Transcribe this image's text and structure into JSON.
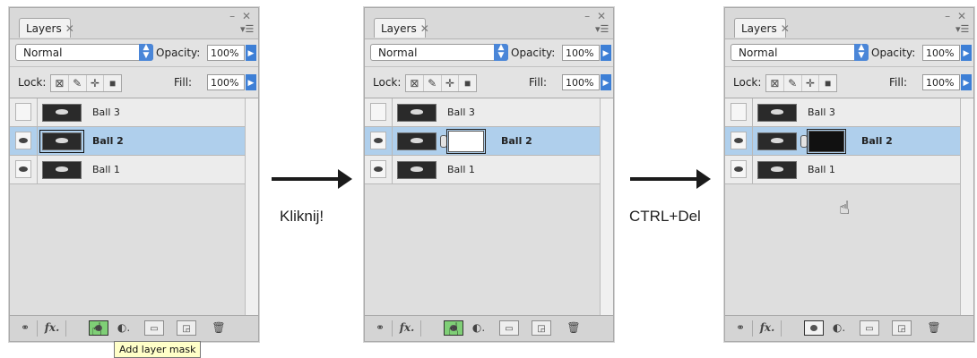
{
  "panels": [
    {
      "tab_label": "Layers",
      "blend_mode": "Normal",
      "opacity_label": "Opacity:",
      "opacity_value": "100%",
      "lock_label": "Lock:",
      "fill_label": "Fill:",
      "fill_value": "100%",
      "layers": [
        {
          "name": "Ball 3",
          "visible": false,
          "selected": false
        },
        {
          "name": "Ball 2",
          "visible": true,
          "selected": true
        },
        {
          "name": "Ball 1",
          "visible": true,
          "selected": false
        }
      ]
    },
    {
      "tab_label": "Layers",
      "blend_mode": "Normal",
      "opacity_label": "Opacity:",
      "opacity_value": "100%",
      "lock_label": "Lock:",
      "fill_label": "Fill:",
      "fill_value": "100%",
      "layers": [
        {
          "name": "Ball 3",
          "visible": false,
          "selected": false
        },
        {
          "name": "Ball 2",
          "visible": true,
          "selected": true,
          "mask": "white"
        },
        {
          "name": "Ball 1",
          "visible": true,
          "selected": false
        }
      ]
    },
    {
      "tab_label": "Layers",
      "blend_mode": "Normal",
      "opacity_label": "Opacity:",
      "opacity_value": "100%",
      "lock_label": "Lock:",
      "fill_label": "Fill:",
      "fill_value": "100%",
      "layers": [
        {
          "name": "Ball 3",
          "visible": false,
          "selected": false
        },
        {
          "name": "Ball 2",
          "visible": true,
          "selected": true,
          "mask": "black"
        },
        {
          "name": "Ball 1",
          "visible": true,
          "selected": false
        }
      ]
    }
  ],
  "tooltip": "Add layer mask",
  "steps": [
    {
      "label": "Kliknij!"
    },
    {
      "label": "CTRL+Del"
    }
  ],
  "bottom_bar_icons": [
    "link-icon",
    "fx-icon",
    "add-layer-mask-icon",
    "adjustment-layer-icon",
    "new-group-icon",
    "new-layer-icon",
    "trash-icon"
  ],
  "colors": {
    "selected_row": "#afcfec",
    "mask_button_active": "#7fcf76",
    "tooltip_bg": "#ffffc8",
    "arrow": "#1b1b1b"
  }
}
